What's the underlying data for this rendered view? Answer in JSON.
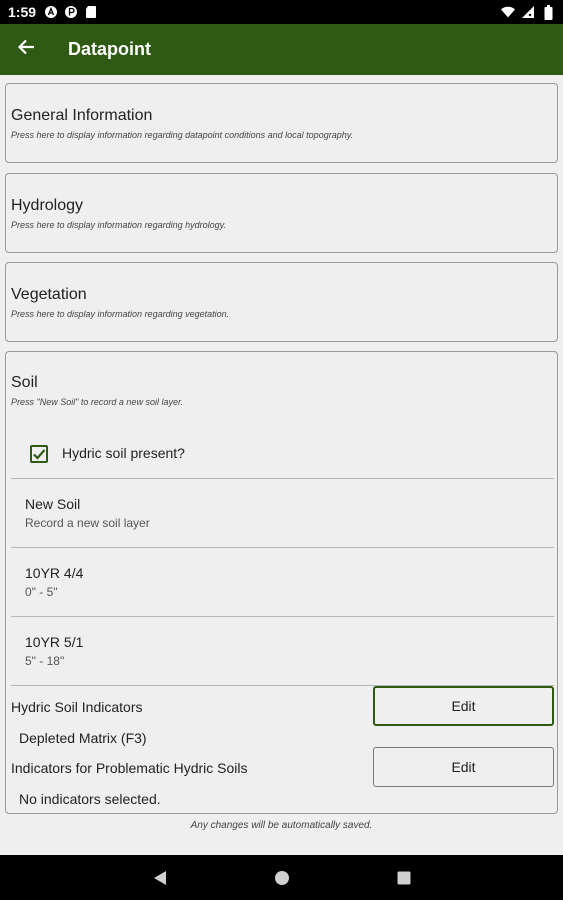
{
  "status_bar": {
    "time": "1:59"
  },
  "app_bar": {
    "title": "Datapoint",
    "back_icon": "arrow-left-icon"
  },
  "sections": {
    "general": {
      "title": "General Information",
      "subtitle": "Press here to display information regarding datapoint conditions and local topography."
    },
    "hydrology": {
      "title": "Hydrology",
      "subtitle": "Press here to display information regarding hydrology."
    },
    "vegetation": {
      "title": "Vegetation",
      "subtitle": "Press here to display information regarding vegetation."
    },
    "soil": {
      "title": "Soil",
      "subtitle": "Press \"New Soil\" to record a new soil layer.",
      "hydric_label": "Hydric soil present?",
      "hydric_checked": true,
      "layers": [
        {
          "name": "New Soil",
          "detail": "Record a new soil layer"
        },
        {
          "name": "10YR 4/4",
          "detail": "0\" - 5\""
        },
        {
          "name": "10YR 5/1",
          "detail": "5\" - 18\""
        }
      ],
      "hydric_indicators": {
        "label": "Hydric Soil Indicators",
        "value": "Depleted Matrix (F3)",
        "button": "Edit"
      },
      "problematic_indicators": {
        "label": "Indicators for Problematic Hydric Soils",
        "value": "No indicators selected.",
        "button": "Edit"
      }
    }
  },
  "footer_note": "Any changes will be automatically saved.",
  "colors": {
    "app_bar": "#2f5a14",
    "accent": "#2f5a14",
    "background": "#efefef"
  }
}
